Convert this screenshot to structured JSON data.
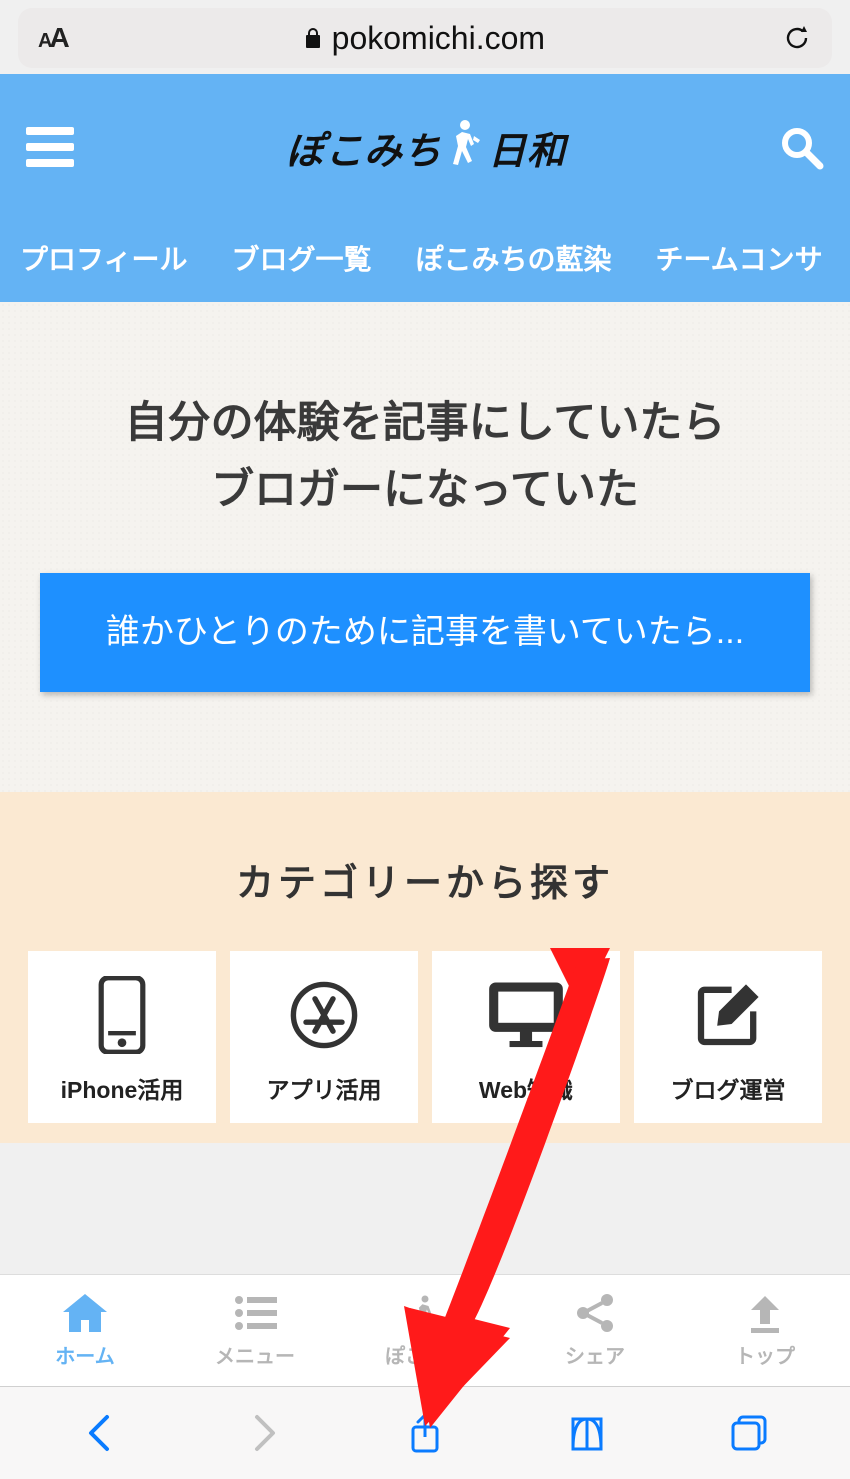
{
  "browser": {
    "domain": "pokomichi.com"
  },
  "header": {
    "logo_left": "ぽこみち",
    "logo_right": "日和"
  },
  "nav": {
    "items": [
      "プロフィール",
      "ブログ一覧",
      "ぽこみちの藍染",
      "チームコンサ"
    ]
  },
  "hero": {
    "title": "自分の体験を記事にしていたら\nブロガーになっていた",
    "cta": "誰かひとりのために記事を書いていたら..."
  },
  "categories": {
    "title": "カテゴリーから探す",
    "items": [
      {
        "label": "iPhone活用"
      },
      {
        "label": "アプリ活用"
      },
      {
        "label": "Web知識"
      },
      {
        "label": "ブログ運営"
      }
    ]
  },
  "bottom_nav": {
    "items": [
      {
        "label": "ホーム"
      },
      {
        "label": "メニュー"
      },
      {
        "label": "ぽこみち"
      },
      {
        "label": "シェア"
      },
      {
        "label": "トップ"
      }
    ]
  }
}
